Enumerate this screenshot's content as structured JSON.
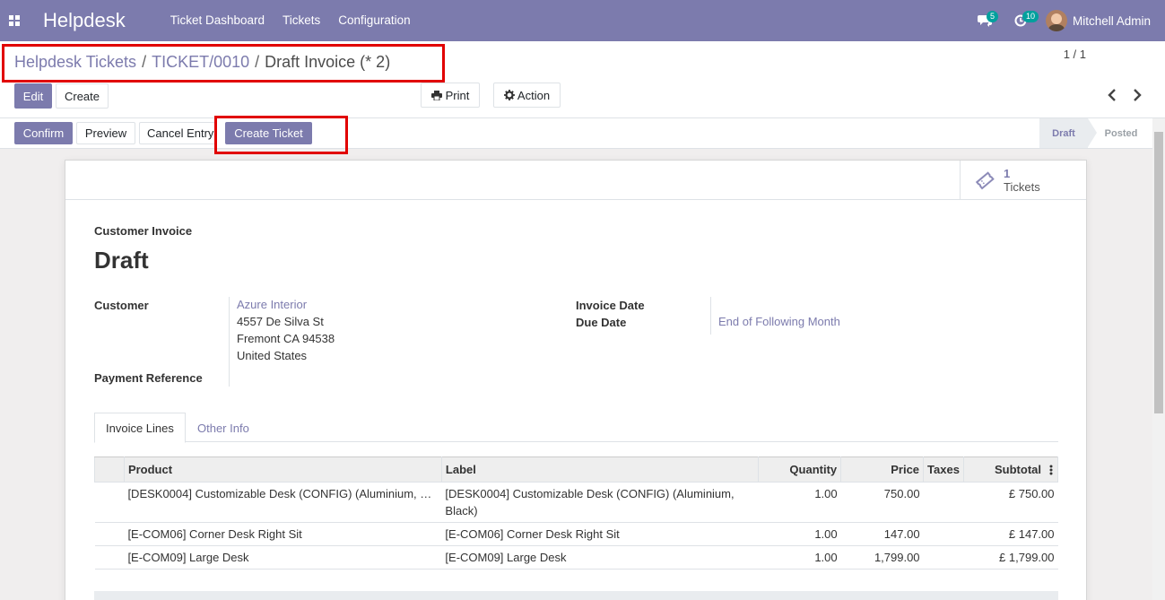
{
  "navbar": {
    "brand": "Helpdesk",
    "menu": [
      "Ticket Dashboard",
      "Tickets",
      "Configuration"
    ],
    "chat_count": "5",
    "activity_count": "10",
    "user_name": "Mitchell Admin"
  },
  "breadcrumb": {
    "root": "Helpdesk Tickets",
    "ticket": "TICKET/0010",
    "current": "Draft Invoice (* 2)"
  },
  "toolbar": {
    "edit": "Edit",
    "create": "Create",
    "print": "Print",
    "action": "Action",
    "pager": "1 / 1"
  },
  "statusbar": {
    "confirm": "Confirm",
    "preview": "Preview",
    "cancel_entry": "Cancel Entry",
    "create_ticket": "Create Ticket",
    "stages": [
      "Draft",
      "Posted"
    ]
  },
  "smart_button": {
    "count": "1",
    "label": "Tickets"
  },
  "invoice": {
    "subtitle": "Customer Invoice",
    "title": "Draft",
    "customer_label": "Customer",
    "customer_name": "Azure Interior",
    "address": [
      "4557 De Silva St",
      "Fremont CA 94538",
      "United States"
    ],
    "payment_ref_label": "Payment Reference",
    "invoice_date_label": "Invoice Date",
    "due_date_label": "Due Date",
    "due_date_value": "End of Following Month"
  },
  "tabs": [
    "Invoice Lines",
    "Other Info"
  ],
  "lines": {
    "headers": [
      "Product",
      "Label",
      "Quantity",
      "Price",
      "Taxes",
      "Subtotal"
    ],
    "rows": [
      {
        "product": "[DESK0004] Customizable Desk (CONFIG) (Aluminium, …",
        "label": "[DESK0004] Customizable Desk (CONFIG) (Aluminium, Black)",
        "quantity": "1.00",
        "price": "750.00",
        "taxes": "",
        "subtotal": "£ 750.00"
      },
      {
        "product": "[E-COM06] Corner Desk Right Sit",
        "label": "[E-COM06] Corner Desk Right Sit",
        "quantity": "1.00",
        "price": "147.00",
        "taxes": "",
        "subtotal": "£ 147.00"
      },
      {
        "product": "[E-COM09] Large Desk",
        "label": "[E-COM09] Large Desk",
        "quantity": "1.00",
        "price": "1,799.00",
        "taxes": "",
        "subtotal": "£ 1,799.00"
      }
    ]
  }
}
